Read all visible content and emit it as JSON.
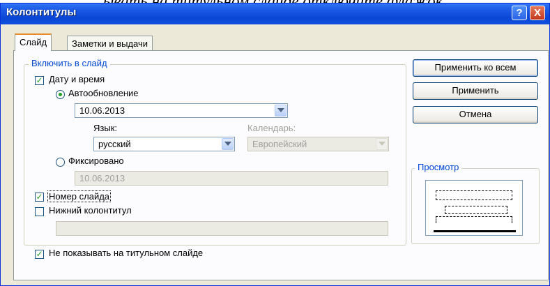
{
  "background_text": "ывать на титульном слайде отключите флажок.",
  "window": {
    "title": "Колонтитулы",
    "help_label": "?",
    "close_label": "X"
  },
  "tabs": [
    {
      "label": "Слайд",
      "active": true
    },
    {
      "label": "Заметки и выдачи",
      "active": false
    }
  ],
  "group": {
    "label": "Включить в слайд",
    "date_time": {
      "label": "Дату и время",
      "checked": true
    },
    "auto_update": {
      "label": "Автообновление",
      "selected": true,
      "value": "10.06.2013"
    },
    "language": {
      "label": "Язык:",
      "value": "русский"
    },
    "calendar": {
      "label": "Календарь:",
      "value": "Европейский",
      "disabled": true
    },
    "fixed": {
      "label": "Фиксировано",
      "selected": false,
      "value": "10.06.2013"
    },
    "slide_number": {
      "label": "Номер слайда",
      "checked": true
    },
    "footer": {
      "label": "Нижний колонтитул",
      "checked": false,
      "value": ""
    }
  },
  "dont_show_title": {
    "label": "Не показывать на титульном слайде",
    "checked": true
  },
  "buttons": {
    "apply_all": "Применить ко всем",
    "apply": "Применить",
    "cancel": "Отмена"
  },
  "preview": {
    "label": "Просмотр"
  },
  "colors": {
    "titlebar": "#0a46d6",
    "group_label": "#0046d5",
    "check": "#21a121"
  }
}
